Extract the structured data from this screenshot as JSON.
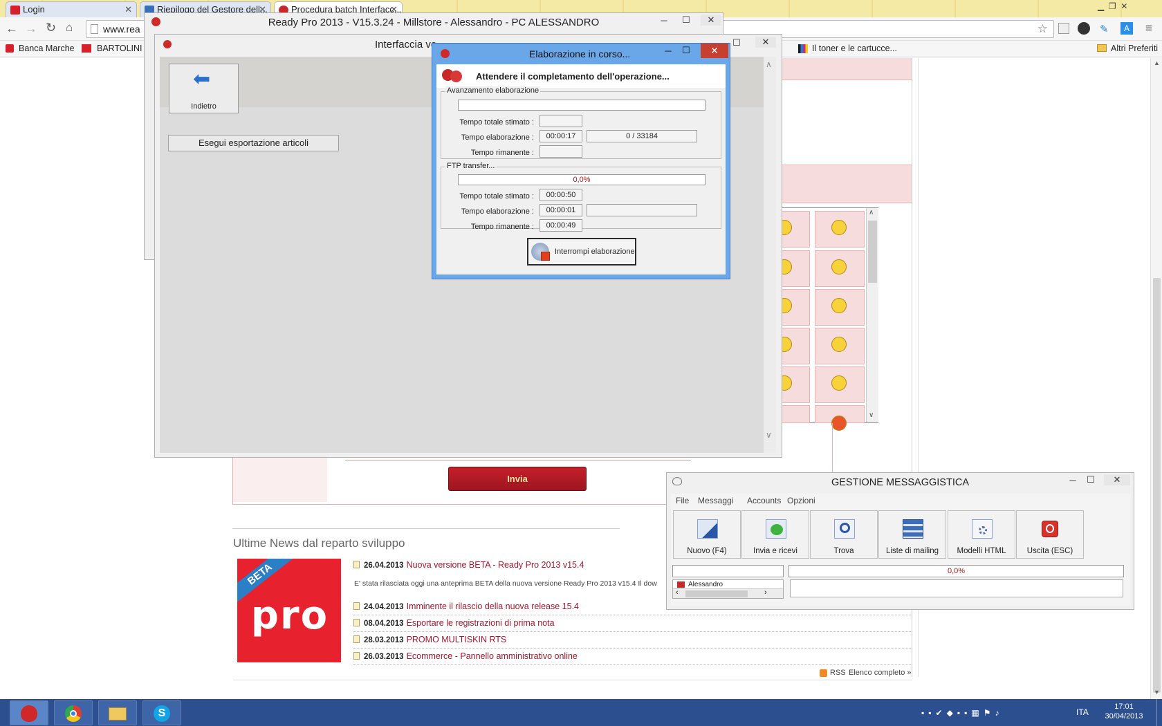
{
  "browser": {
    "tabs": [
      {
        "label": "Login"
      },
      {
        "label": "Riepilogo del Gestore dell..."
      },
      {
        "label": "Procedura batch Interfacc..."
      }
    ],
    "address": "www.rea",
    "bookmarks": [
      "Banca Marche",
      "BARTOLINI T",
      "Il toner e le cartucce...",
      "Altri Preferiti"
    ]
  },
  "main_window": {
    "title": "Ready Pro 2013 - V15.3.24 - Millstore - Alessandro - PC ALESSANDRO"
  },
  "sub_window": {
    "title": "Interfaccia ve",
    "back_label": "Indietro",
    "export_button": "Esegui esportazione articoli"
  },
  "progress_dialog": {
    "title": "Elaborazione in corso...",
    "heading": "Attendere il completamento dell'operazione...",
    "group1": {
      "caption": "Avanzamento elaborazione",
      "progress": 0,
      "label_total": "Tempo totale stimato :",
      "label_elapsed": "Tempo elaborazione :",
      "label_remaining": "Tempo rimanente :",
      "total": "",
      "elapsed": "00:00:17",
      "counter": "0 / 33184",
      "remaining": ""
    },
    "group2": {
      "caption": "FTP transfer...",
      "progress_text": "0,0%",
      "progress": 0,
      "label_total": "Tempo totale stimato :",
      "label_elapsed": "Tempo elaborazione :",
      "label_remaining": "Tempo rimanente :",
      "total": "00:00:50",
      "elapsed": "00:00:01",
      "remaining": "00:00:49"
    },
    "stop_button": "Interrompi elaborazione"
  },
  "page": {
    "send_button": "Invia",
    "news_heading": "Ultime News dal reparto sviluppo",
    "beta_badge": "BETA",
    "promo_logo": "pro",
    "news": [
      {
        "date": "26.04.2013",
        "title": "Nuova versione BETA - Ready Pro 2013 v15.4",
        "excerpt": "E' stata rilasciata oggi una anteprima BETA della nuova versione Ready Pro 2013 v15.4 Il dow"
      },
      {
        "date": "24.04.2013",
        "title": "Imminente il rilascio della nuova release 15.4"
      },
      {
        "date": "08.04.2013",
        "title": "Esportare le registrazioni di prima nota"
      },
      {
        "date": "28.03.2013",
        "title": "PROMO MULTISKIN RTS"
      },
      {
        "date": "26.03.2013",
        "title": "Ecommerce - Pannello amministrativo online"
      }
    ],
    "rss": "RSS",
    "full_list": "Elenco completo »"
  },
  "messaging": {
    "title": "GESTIONE MESSAGGISTICA",
    "menu": [
      "File",
      "Messaggi",
      "Accounts",
      "Opzioni"
    ],
    "buttons": [
      "Nuovo (F4)",
      "Invia e ricevi",
      "Trova",
      "Liste di mailing",
      "Modelli HTML",
      "Uscita (ESC)"
    ],
    "progress_text": "0,0%",
    "account": "Alessandro"
  },
  "taskbar": {
    "language": "ITA",
    "time": "17:01",
    "date": "30/04/2013"
  }
}
